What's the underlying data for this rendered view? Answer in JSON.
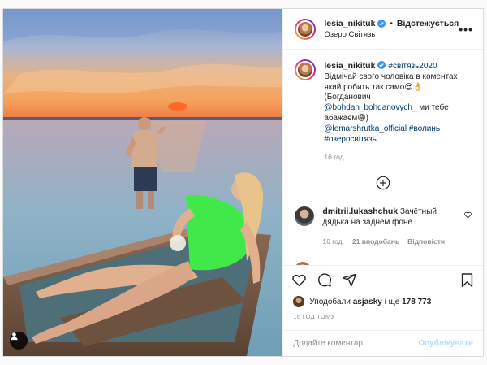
{
  "header": {
    "username": "lesia_nikituk",
    "follow_status": "Відстежується",
    "location": "Озеро Світязь",
    "more_label": "•••"
  },
  "caption": {
    "username": "lesia_nikituk",
    "hashtag": "#світязь2020",
    "text_line1": "Відмічай свого чоловіка в коментах",
    "text_line2": "який робить так само😎👌",
    "text_line3": "(Богданович",
    "mention1": "@bohdan_bohdanovych_",
    "text_after_mention1": " ми тебе",
    "text_line4": "абажаєм😁)",
    "mention2": "@lemarshrutka_official",
    "hashtag2": "#волинь",
    "hashtag3": "#озеросвітязь",
    "time": "16 год."
  },
  "comment": {
    "username": "dmitrii.lukashchuk",
    "text": "Зачётный дядька на заднем фоне",
    "time": "16 год.",
    "likes": "21 вподобань",
    "reply": "Відповісти"
  },
  "likes": {
    "prefix": "Уподобали",
    "user": "asjasky",
    "middle": "і ще",
    "count": "178 773"
  },
  "timestamp": "16 ГОД ТОМУ",
  "add_comment": {
    "placeholder": "Додайте коментар...",
    "post_label": "Опублікувати"
  },
  "colors": {
    "verified": "#3897f0",
    "link": "#00376b",
    "muted": "#8e8e8e",
    "post_disabled": "#b2dffc"
  }
}
